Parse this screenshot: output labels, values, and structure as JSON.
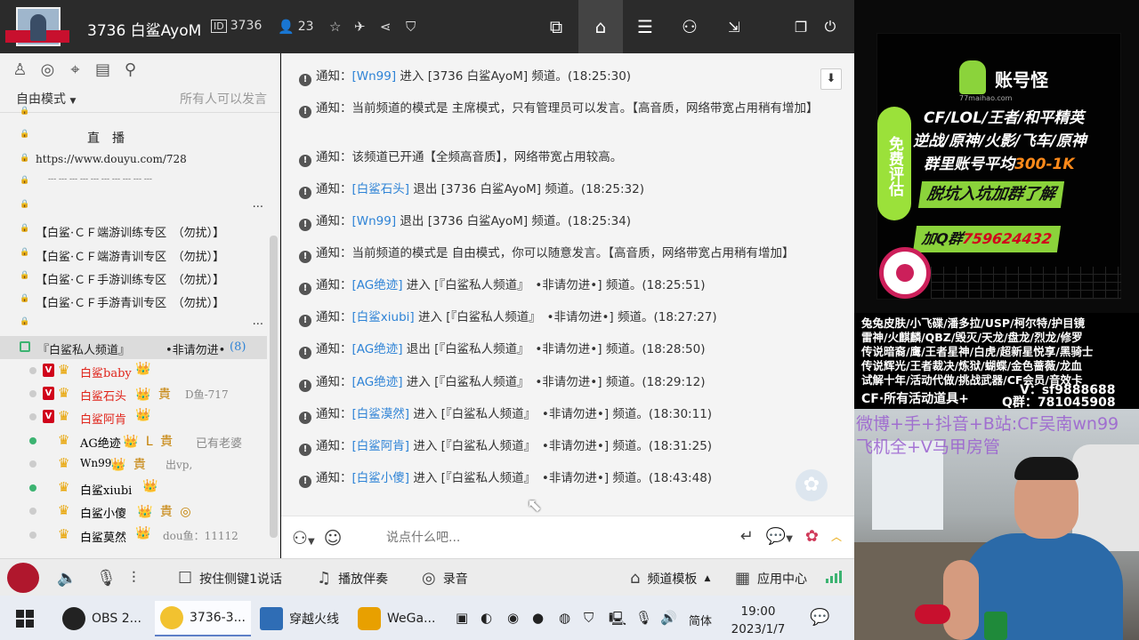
{
  "titlebar": {
    "channel_title": "3736 白鲨AyoM",
    "id_icon": "ID",
    "channel_id": "3736",
    "online_count": "23",
    "right_tabs": [
      {
        "name": "video-icon",
        "glyph": "▶"
      },
      {
        "name": "home-icon",
        "glyph": "⌂"
      },
      {
        "name": "list-icon",
        "glyph": "☰"
      },
      {
        "name": "gamepad-icon",
        "glyph": "⌨"
      },
      {
        "name": "download-icon",
        "glyph": "⇲"
      },
      {
        "name": "restore-icon",
        "glyph": "❐"
      },
      {
        "name": "power-icon",
        "glyph": "⏻"
      }
    ]
  },
  "left_panel": {
    "mode_label": "自由模式",
    "mode_hint": "所有人可以发言",
    "channels": [
      {
        "text": "",
        "top": 0
      },
      {
        "text": "直　播"
      },
      {
        "text": "https://www.douyu.com/728"
      },
      {
        "text": "--- --- --- --- --- --- --- --- --- ---"
      },
      {
        "text": ""
      },
      {
        "text": "【白鲨·ＣＦ端游训练专区　（勿扰）】"
      },
      {
        "text": "【白鲨·ＣＦ端游青训专区　（勿扰）】"
      },
      {
        "text": "【白鲨·ＣＦ手游训练专区　（勿扰）】"
      },
      {
        "text": "【白鲨·ＣＦ手游青训专区　（勿扰）】"
      },
      {
        "text": ""
      }
    ],
    "selected_channel": {
      "name": "『白鲨私人频道』",
      "suffix": "•非请勿进•",
      "count": "(8)"
    },
    "users": [
      {
        "name": "白鲨baby",
        "badges": "👑",
        "note": ""
      },
      {
        "name": "白鲨石头",
        "badges": "👑 貴",
        "note": "D鱼-717"
      },
      {
        "name": "白鲨阿肯",
        "badges": "👑",
        "note": ""
      },
      {
        "name": "AG绝迹",
        "badges": "👑 L 貴",
        "note": "已有老婆"
      },
      {
        "name": "Wn99",
        "badges": "👑 貴",
        "note": "出vp,"
      },
      {
        "name": "白鲨xiubi",
        "badges": "👑",
        "note": ""
      },
      {
        "name": "白鲨小傻",
        "badges": "👑 貴 ◎",
        "note": ""
      },
      {
        "name": "白鲨莫然",
        "badges": "👑",
        "note": "dou鱼：11112"
      }
    ],
    "more": "..."
  },
  "chat": {
    "prefix": "通知：",
    "messages": [
      {
        "who": "[Wn99]",
        "text": " 进入 [3736 白鲨AyoM] 频道。(18:25:30)"
      },
      {
        "who": "",
        "text": "当前频道的模式是 主席模式，只有管理员可以发言。【高音质，网络带宽占用稍有增加】"
      },
      {
        "who": "",
        "text": "该频道已开通【全频高音质】，网络带宽占用较高。"
      },
      {
        "who": "[白鲨石头]",
        "text": " 退出 [3736 白鲨AyoM] 频道。(18:25:32)"
      },
      {
        "who": "[Wn99]",
        "text": " 退出 [3736 白鲨AyoM] 频道。(18:25:34)"
      },
      {
        "who": "",
        "text": "当前频道的模式是 自由模式，你可以随意发言。【高音质，网络带宽占用稍有增加】"
      },
      {
        "who": "[AG绝迹]",
        "text": " 进入 [『白鲨私人频道』　•非请勿进•] 频道。(18:25:51)"
      },
      {
        "who": "[白鲨xiubi]",
        "text": " 进入 [『白鲨私人频道』　•非请勿进•] 频道。(18:27:27)"
      },
      {
        "who": "[AG绝迹]",
        "text": " 退出 [『白鲨私人频道』　•非请勿进•] 频道。(18:28:50)"
      },
      {
        "who": "[AG绝迹]",
        "text": " 进入 [『白鲨私人频道』　•非请勿进•] 频道。(18:29:12)"
      },
      {
        "who": "[白鲨漠然]",
        "text": " 进入 [『白鲨私人频道』　•非请勿进•] 频道。(18:30:11)"
      },
      {
        "who": "[白鲨阿肯]",
        "text": " 进入 [『白鲨私人频道』　•非请勿进•] 频道。(18:31:25)"
      },
      {
        "who": "[白鲨小傻]",
        "text": " 进入 [『白鲨私人频道』　•非请勿进•] 频道。(18:43:48)"
      }
    ],
    "input_placeholder": "说点什么吧..."
  },
  "bottombar": {
    "push_to_talk": "按住侧键1说话",
    "play_music": "播放伴奏",
    "record": "录音",
    "template": "频道模板",
    "app_center": "应用中心"
  },
  "taskbar": {
    "tasks": [
      {
        "label": "OBS 2...",
        "color": "#222222"
      },
      {
        "label": "3736-3...",
        "color": "#f2c230"
      },
      {
        "label": "穿越火线",
        "color": "#2f6db5"
      },
      {
        "label": "WeGa...",
        "color": "#e8a000"
      }
    ],
    "ime": "简体",
    "time": "19:00",
    "date": "2023/1/7"
  },
  "overlay": {
    "ad_brand": "账号怪",
    "ad_brand_sub": "77maihao.com",
    "ad_badge": "免费评估",
    "ad_line1": "CF/LOL/王者/和平精英",
    "ad_line2": "逆战/原神/火影/飞车/原神",
    "ad_line3_a": "群里账号平均",
    "ad_line3_b": "300-1K",
    "ad_button1": "脱坑入坑加群了解",
    "ad_button2_a": "加Q群",
    "ad_button2_b": "759624432",
    "promo_lines": [
      "兔兔皮肤/小飞碟/潘多拉/USP/柯尔特/护目镜",
      "雷神/火麒麟/QBZ/毁灭/天龙/盘龙/烈龙/修罗",
      "传说暗裔/鹰/王者星神/白虎/超新星悦享/黑骑士",
      "传说辉光/王者裁决/炼狱/蝴蝶/金色蔷薇/龙血",
      "试解十年/活动代做/挑战武器/CF会员/音效卡"
    ],
    "promo_cf": "CF·所有活动道具+",
    "promo_v": "V：sf9888688",
    "promo_q": "Q群：781045908",
    "cam_line1": "微博+手+抖音+B站:CF吴南wn99",
    "cam_line2": "飞机全+V马甲房管"
  },
  "colors": {
    "link_blue": "#2e83d6",
    "owner_red": "#e0241a",
    "online_green": "#3cb371",
    "ad_green": "#8bd33b",
    "ad_orange": "#ff8a1a"
  }
}
